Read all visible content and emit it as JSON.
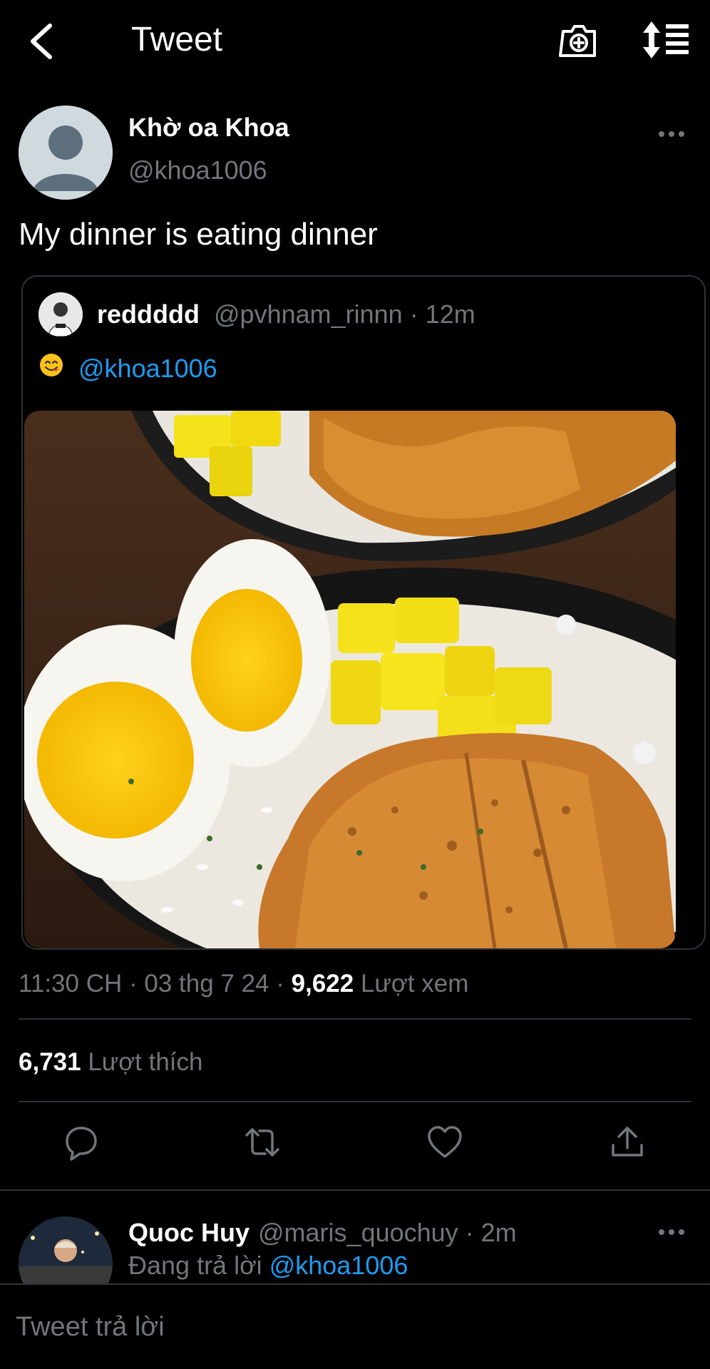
{
  "header": {
    "title": "Tweet",
    "icons": [
      "back-arrow-icon",
      "camera-plus-icon",
      "sort-list-icon"
    ]
  },
  "tweet": {
    "author_name": "Khờ oa Khoa",
    "author_handle": "@khoa1006",
    "text": "My dinner is eating dinner",
    "quoted": {
      "name": "reddddd",
      "handle_time": "@pvhnam_rinnn · 12m",
      "emoji": "😋",
      "mention": "@khoa1006"
    },
    "meta": {
      "time_date": "11:30 CH · 03 thg 7 24 · ",
      "views_count": "9,622",
      "views_label": " Lượt xem"
    },
    "likes": {
      "count": "6,731",
      "label": " Lượt thích"
    }
  },
  "reply": {
    "name": "Quoc Huy",
    "handle_time": "@maris_quochuy · 2m",
    "replying_prefix": "Đang trả lời ",
    "replying_mention": "@khoa1006"
  },
  "composer": {
    "placeholder": "Tweet trả lời"
  },
  "colors": {
    "background": "#000000",
    "accent": "#1d9bf0",
    "muted": "#71767b",
    "divider": "#2f3336"
  }
}
